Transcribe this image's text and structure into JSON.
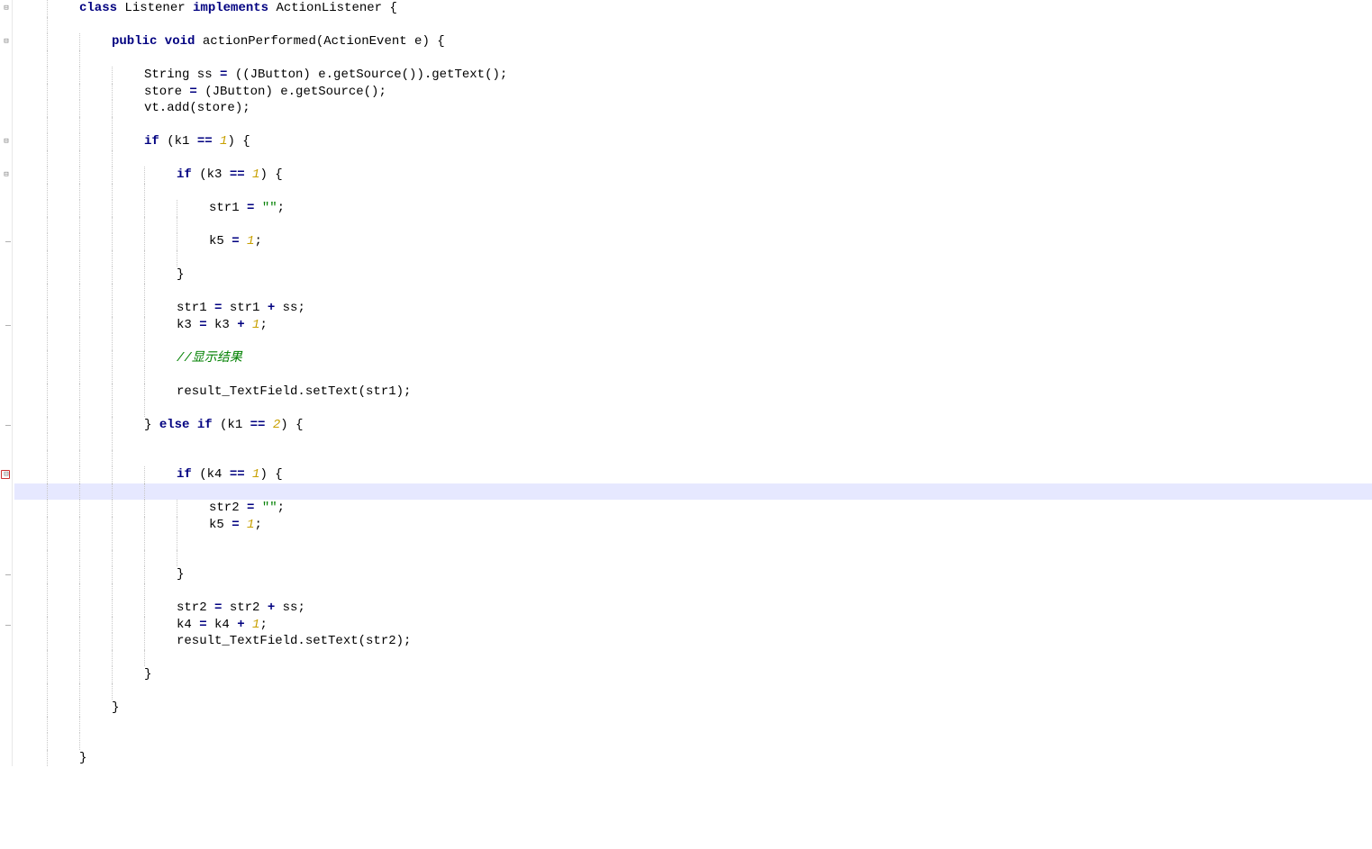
{
  "code": {
    "lines": [
      {
        "indent": 2,
        "html": "<span class='kw'>class</span> Listener <span class='kw'>implements</span> ActionListener {"
      },
      {
        "indent": 2,
        "html": ""
      },
      {
        "indent": 3,
        "html": "<span class='kw'>public void</span> actionPerformed(ActionEvent e) {"
      },
      {
        "indent": 3,
        "html": ""
      },
      {
        "indent": 4,
        "html": "String ss <span class='op'>=</span> ((JButton) e.getSource()).getText();"
      },
      {
        "indent": 4,
        "html": "store <span class='op'>=</span> (JButton) e.getSource();"
      },
      {
        "indent": 4,
        "html": "vt.add(store);"
      },
      {
        "indent": 4,
        "html": ""
      },
      {
        "indent": 4,
        "html": "<span class='kw'>if</span> (k1 <span class='op'>==</span> <span class='num'>1</span>) {"
      },
      {
        "indent": 4,
        "html": ""
      },
      {
        "indent": 5,
        "html": "<span class='kw'>if</span> (k3 <span class='op'>==</span> <span class='num'>1</span>) {"
      },
      {
        "indent": 5,
        "html": ""
      },
      {
        "indent": 6,
        "html": "str1 <span class='op'>=</span> <span class='str'>\"\"</span>;"
      },
      {
        "indent": 6,
        "html": ""
      },
      {
        "indent": 6,
        "html": "k5 <span class='op'>=</span> <span class='num'>1</span>;"
      },
      {
        "indent": 6,
        "html": ""
      },
      {
        "indent": 5,
        "html": "}"
      },
      {
        "indent": 5,
        "html": ""
      },
      {
        "indent": 5,
        "html": "str1 <span class='op'>=</span> str1 <span class='op'>+</span> ss;"
      },
      {
        "indent": 5,
        "html": "k3 <span class='op'>=</span> k3 <span class='op'>+</span> <span class='num'>1</span>;"
      },
      {
        "indent": 5,
        "html": ""
      },
      {
        "indent": 5,
        "html": "<span class='cmt'>//显示结果</span>"
      },
      {
        "indent": 5,
        "html": ""
      },
      {
        "indent": 5,
        "html": "result_TextField.setText(str1);"
      },
      {
        "indent": 5,
        "html": ""
      },
      {
        "indent": 4,
        "html": "} <span class='kw'>else if</span> (k1 <span class='op'>==</span> <span class='num'>2</span>) {"
      },
      {
        "indent": 4,
        "html": ""
      },
      {
        "indent": 4,
        "html": ""
      },
      {
        "indent": 5,
        "html": "<span class='kw'>if</span> (k4 <span class='op'>==</span> <span class='num'>1</span>) {",
        "highlight": false
      },
      {
        "indent": 5,
        "html": "",
        "highlight": true
      },
      {
        "indent": 6,
        "html": "str2 <span class='op'>=</span> <span class='str'>\"\"</span>;"
      },
      {
        "indent": 6,
        "html": "k5 <span class='op'>=</span> <span class='num'>1</span>;"
      },
      {
        "indent": 6,
        "html": ""
      },
      {
        "indent": 6,
        "html": ""
      },
      {
        "indent": 5,
        "html": "}"
      },
      {
        "indent": 5,
        "html": ""
      },
      {
        "indent": 5,
        "html": "str2 <span class='op'>=</span> str2 <span class='op'>+</span> ss;"
      },
      {
        "indent": 5,
        "html": "k4 <span class='op'>=</span> k4 <span class='op'>+</span> <span class='num'>1</span>;"
      },
      {
        "indent": 5,
        "html": "result_TextField.setText(str2);"
      },
      {
        "indent": 5,
        "html": ""
      },
      {
        "indent": 4,
        "html": "}"
      },
      {
        "indent": 4,
        "html": ""
      },
      {
        "indent": 3,
        "html": "}"
      },
      {
        "indent": 3,
        "html": ""
      },
      {
        "indent": 3,
        "html": ""
      },
      {
        "indent": 2,
        "html": "}"
      }
    ]
  },
  "gutter": {
    "fold_marks_at": [
      0,
      2,
      8,
      10,
      28
    ],
    "dash_marks_at": [
      14,
      19,
      25,
      34,
      37
    ],
    "red_mark_at": 28
  }
}
